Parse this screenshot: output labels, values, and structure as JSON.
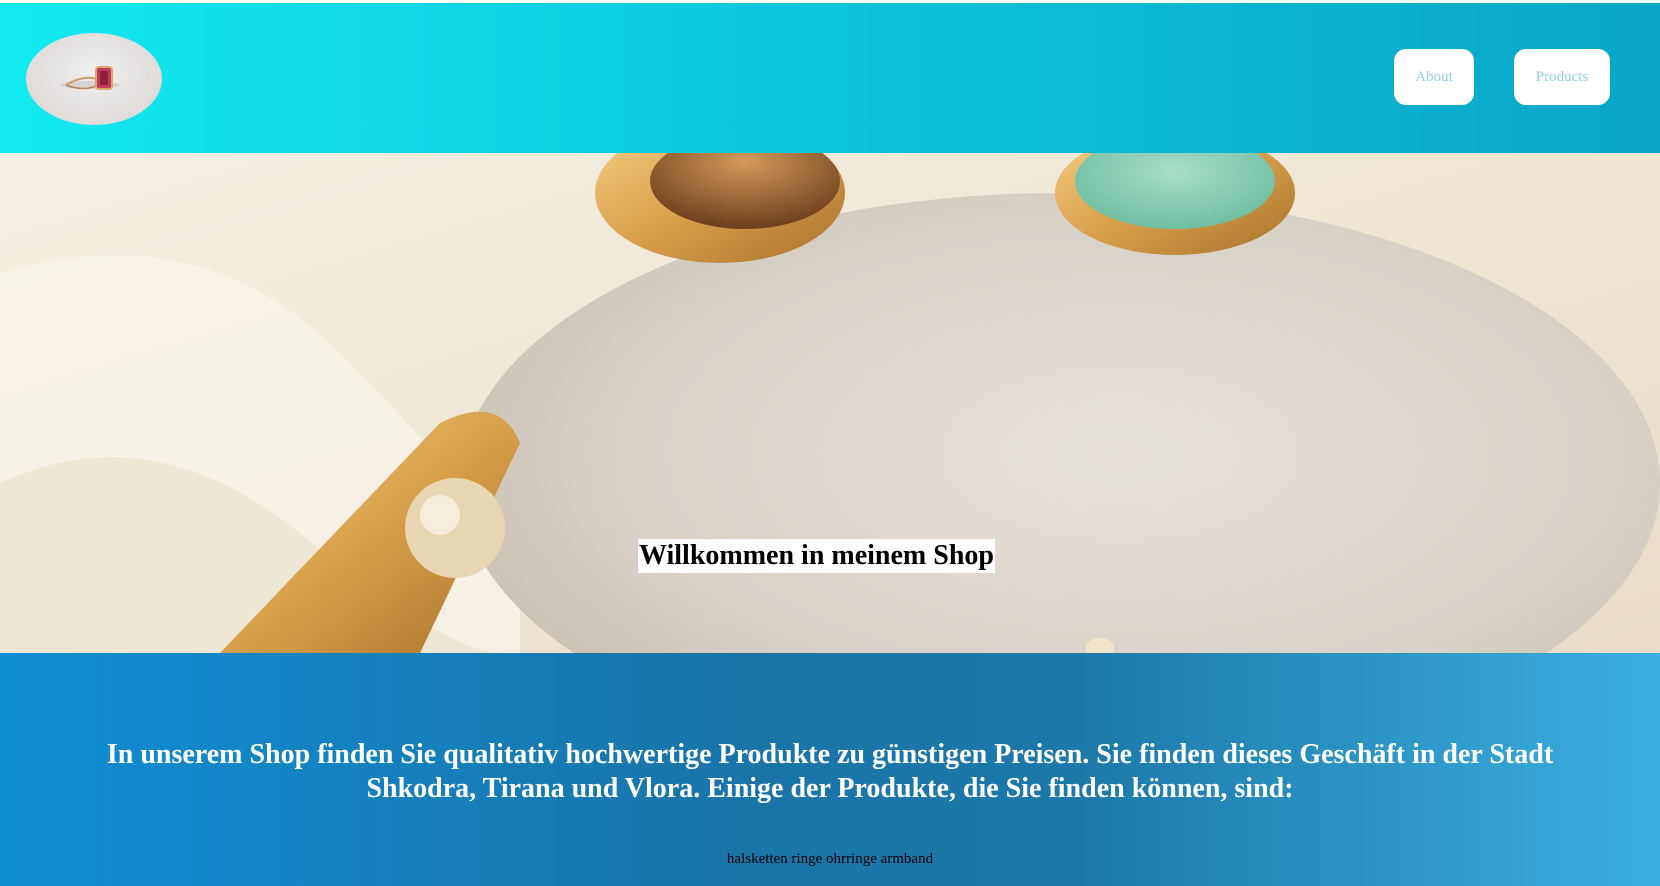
{
  "header": {
    "logo_alt": "ring logo",
    "nav": {
      "about_label": "About",
      "products_label": "Products"
    }
  },
  "hero": {
    "title": "Willkommen in meinem Shop"
  },
  "info": {
    "description": "In unserem Shop finden Sie qualitativ hochwertige Produkte zu günstigen Preisen. Sie finden dieses Geschäft in der Stadt Shkodra, Tirana und Vlora. Einige der Produkte, die Sie finden können, sind:",
    "categories": "halsketten ringe ohrringe armband"
  },
  "colors": {
    "header_start": "#12eaf1",
    "header_end": "#0aa6c7",
    "info_start": "#0f8ed4",
    "info_end": "#3aafe0",
    "nav_text": "#8fd3e6"
  }
}
